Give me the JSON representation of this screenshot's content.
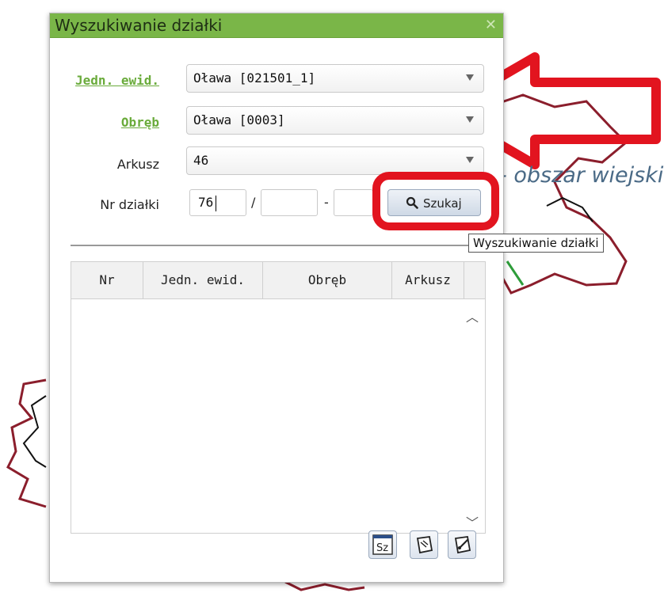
{
  "dialog": {
    "title": "Wyszukiwanie działki"
  },
  "form": {
    "jedn_label": "Jedn. ewid.",
    "jedn_value": "Oława [021501_1]",
    "obreb_label": "Obręb",
    "obreb_value": "Oława [0003]",
    "arkusz_label": "Arkusz",
    "arkusz_value": "46",
    "nr_label": "Nr działki",
    "nr_value": "76",
    "slash": "/",
    "dash": "-",
    "search_label": "Szukaj"
  },
  "table": {
    "columns": [
      "Nr",
      "Jedn. ewid.",
      "Obręb",
      "Arkusz"
    ]
  },
  "map": {
    "area_label": "- obszar wiejski"
  },
  "tooltip": {
    "text": "Wyszukiwanie działki"
  },
  "toolbar": {
    "sz_label": "Sz"
  },
  "colors": {
    "accent": "#7ab648",
    "link": "#6aab3b",
    "annotation": "#e2141f",
    "boundary": "#8b1e2c"
  }
}
